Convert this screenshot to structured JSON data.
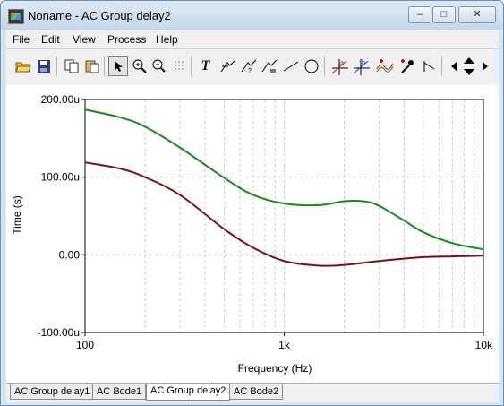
{
  "window": {
    "title": "Noname - AC Group delay2",
    "min_label": "–",
    "max_label": "□",
    "close_label": "✕"
  },
  "menu": [
    "File",
    "Edit",
    "View",
    "Process",
    "Help"
  ],
  "toolbar": {
    "icons": [
      "open-file-icon",
      "save-icon",
      "copy-icon",
      "paste-icon",
      "pointer-icon",
      "zoom-in-icon",
      "zoom-100-icon",
      "grid-icon",
      "text-icon",
      "cursor-a-icon",
      "cursor-b-icon",
      "axis-icon",
      "line-icon",
      "circle-icon",
      "marker-a-icon",
      "marker-b-icon",
      "multi-trace-icon",
      "eyedropper-icon",
      "fit-icon",
      "scroll-left-icon",
      "scroll-up-down-icon",
      "scroll-right-icon"
    ],
    "text_tool_label": "T"
  },
  "tabs": [
    {
      "label": "AC Group delay1",
      "active": false
    },
    {
      "label": "AC Bode1",
      "active": false
    },
    {
      "label": "AC Group delay2",
      "active": true
    },
    {
      "label": "AC Bode2",
      "active": false
    }
  ],
  "chart_data": {
    "type": "line",
    "title": "",
    "xlabel": "Frequency (Hz)",
    "ylabel": "Time (s)",
    "xscale": "log",
    "xlim": [
      100,
      10000
    ],
    "ylim": [
      -0.0001,
      0.0002
    ],
    "x_tick_labels": [
      "100",
      "1k",
      "10k"
    ],
    "y_tick_labels": [
      "200.00u",
      "100.00u",
      "0.00",
      "-100.00u"
    ],
    "grid": true,
    "series": [
      {
        "color": "#1a8a1a",
        "x": [
          100,
          150,
          200,
          300,
          500,
          700,
          1000,
          1500,
          2000,
          2500,
          3000,
          4000,
          5000,
          7000,
          10000
        ],
        "y": [
          0.000187,
          0.000177,
          0.000165,
          0.000138,
          9.9e-05,
          7.7e-05,
          6.6e-05,
          6.4e-05,
          6.9e-05,
          6.9e-05,
          6.3e-05,
          4.4e-05,
          2.9e-05,
          1.5e-05,
          7e-06
        ]
      },
      {
        "color": "#7a1212",
        "x": [
          100,
          150,
          200,
          300,
          500,
          700,
          1000,
          1500,
          2000,
          3000,
          5000,
          7000,
          10000
        ],
        "y": [
          0.000119,
          0.000111,
          0.0001,
          7.7e-05,
          3.3e-05,
          9e-06,
          -8e-06,
          -1.4e-05,
          -1.3e-05,
          -8e-06,
          -3e-06,
          -2e-06,
          -1e-06
        ]
      }
    ]
  }
}
